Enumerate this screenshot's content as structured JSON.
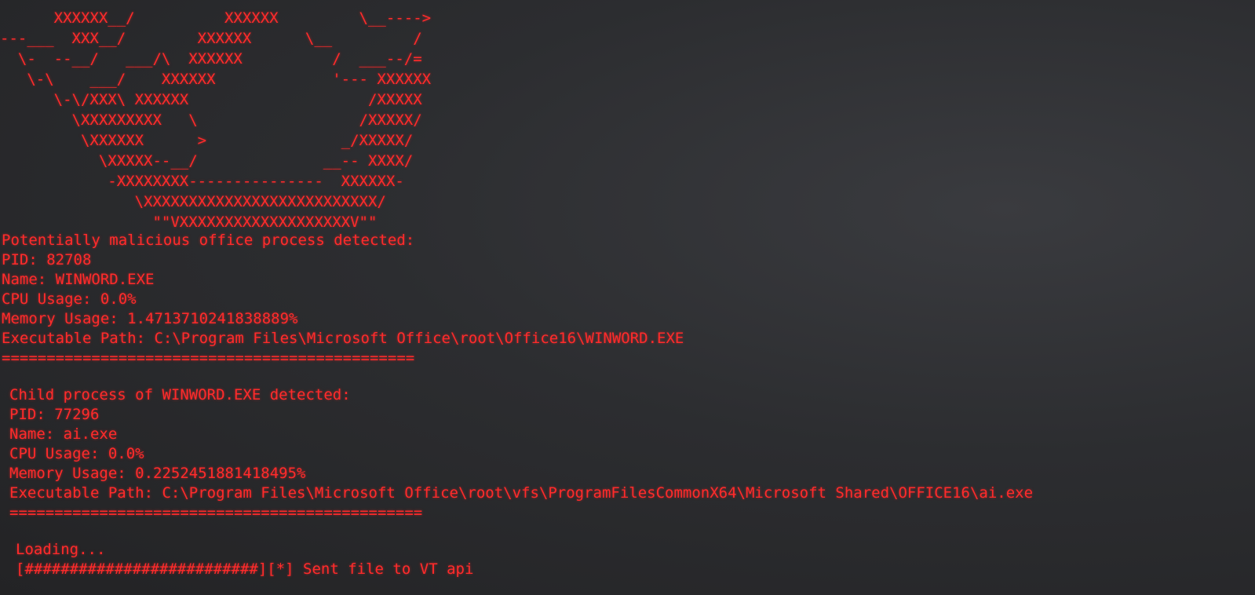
{
  "banner": {
    "lines": [
      "      XXXXXX__/          XXXXXX         \\__---->",
      "---___  XXX__/        XXXXXX      \\__         /",
      "  \\-  --__/   ___/\\  XXXXXX          /  ___--/=",
      "   \\-\\    ___/    XXXXXX             '--- XXXXXX",
      "      \\-\\/XXX\\ XXXXXX                    /XXXXX",
      "        \\XXXXXXXXX   \\                  /XXXXX/",
      "         \\XXXXXX      >               _/XXXXX/",
      "           \\XXXXX--__/              __-- XXXX/",
      "            -XXXXXXXX---------------  XXXXXX-",
      "               \\XXXXXXXXXXXXXXXXXXXXXXXXXX/",
      "                 \"\"VXXXXXXXXXXXXXXXXXXXV\"\""
    ]
  },
  "process": {
    "heading": "Potentially malicious office process detected:",
    "pid": "PID: 82708",
    "name": "Name: WINWORD.EXE",
    "cpu": "CPU Usage: 0.0%",
    "memory": "Memory Usage: 1.4713710241838889%",
    "path": "Executable Path: C:\\Program Files\\Microsoft Office\\root\\Office16\\WINWORD.EXE",
    "separator": "=============================================="
  },
  "child": {
    "heading": "Child process of WINWORD.EXE detected:",
    "pid": "PID: 77296",
    "name": "Name: ai.exe",
    "cpu": "CPU Usage: 0.0%",
    "memory": "Memory Usage: 0.2252451881418495%",
    "path": "Executable Path: C:\\Program Files\\Microsoft Office\\root\\vfs\\ProgramFilesCommonX64\\Microsoft Shared\\OFFICE16\\ai.exe",
    "separator": "=============================================="
  },
  "status": {
    "loading": "Loading...",
    "progress": "[##########################][*] Sent file to VT api"
  },
  "colors": {
    "text": "#ff2b2b",
    "background": "#2a2a2c"
  }
}
